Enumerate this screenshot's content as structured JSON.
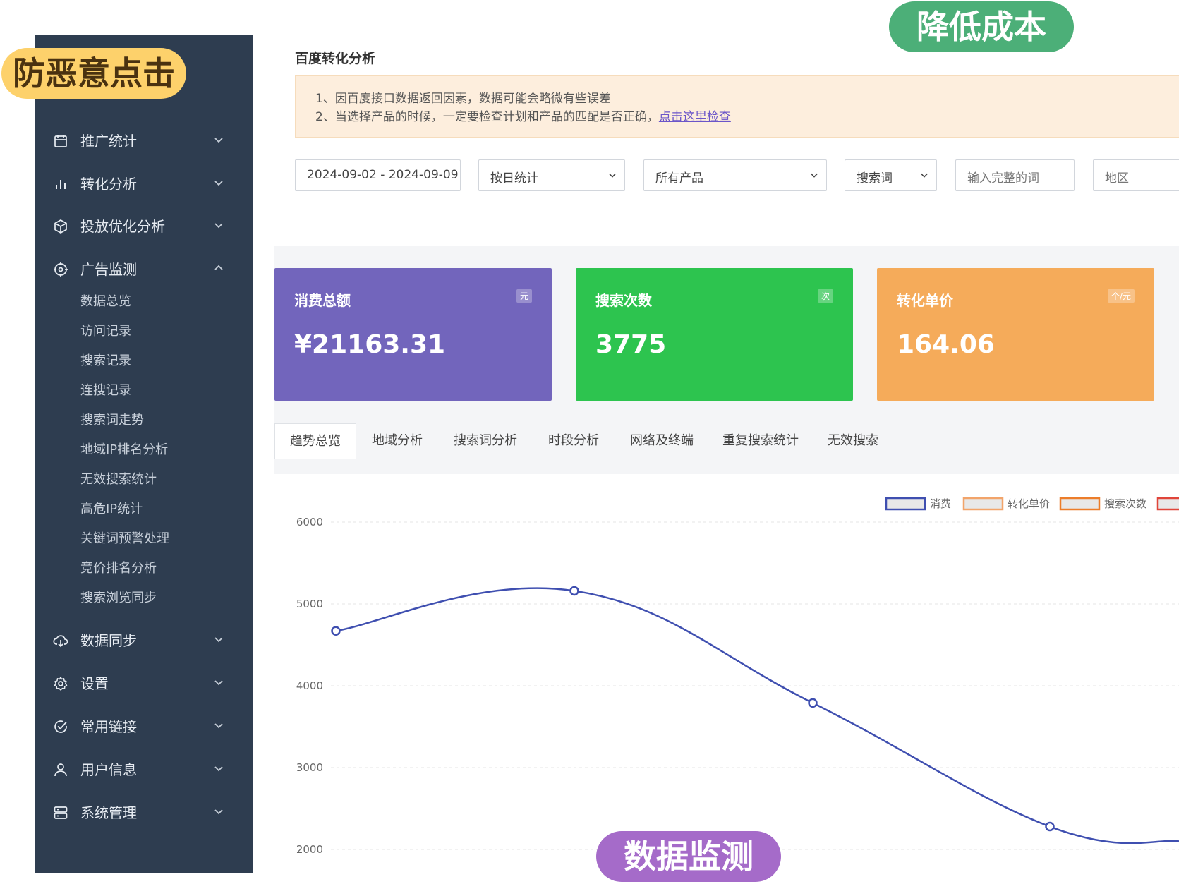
{
  "badges": {
    "top_left": "防恶意点击",
    "top_right": "降低成本",
    "bottom": "数据监测"
  },
  "sidebar": {
    "items": [
      {
        "label": "推广统计",
        "icon": "calendar-icon",
        "expanded": false
      },
      {
        "label": "转化分析",
        "icon": "bar-chart-icon",
        "expanded": false
      },
      {
        "label": "投放优化分析",
        "icon": "cube-icon",
        "expanded": false
      },
      {
        "label": "广告监测",
        "icon": "target-icon",
        "expanded": true
      },
      {
        "label": "数据同步",
        "icon": "cloud-download-icon",
        "expanded": false
      },
      {
        "label": "设置",
        "icon": "gear-icon",
        "expanded": false
      },
      {
        "label": "常用链接",
        "icon": "check-circle-icon",
        "expanded": false
      },
      {
        "label": "用户信息",
        "icon": "user-icon",
        "expanded": false
      },
      {
        "label": "系统管理",
        "icon": "server-icon",
        "expanded": false
      }
    ],
    "sub_items": [
      "数据总览",
      "访问记录",
      "搜索记录",
      "连搜记录",
      "搜索词走势",
      "地域IP排名分析",
      "无效搜索统计",
      "高危IP统计",
      "关键词预警处理",
      "竞价排名分析",
      "搜索浏览同步"
    ]
  },
  "main": {
    "title": "百度转化分析",
    "notice": {
      "line1": "1、因百度接口数据返回因素，数据可能会略微有些误差",
      "line2_prefix": "2、当选择产品的时候，一定要检查计划和产品的匹配是否正确，",
      "line2_link": "点击这里检查"
    },
    "filters": {
      "date_range": "2024-09-02 - 2024-09-09",
      "group_by": "按日统计",
      "product": "所有产品",
      "field": "搜索词",
      "keyword_placeholder": "输入完整的词",
      "region": "地区"
    },
    "stats": [
      {
        "title": "消费总额",
        "unit": "元",
        "value": "¥21163.31",
        "color": "#7265bc"
      },
      {
        "title": "搜索次数",
        "unit": "次",
        "value": "3775",
        "color": "#2dc44f"
      },
      {
        "title": "转化单价",
        "unit": "个/元",
        "value": "164.06",
        "color": "#f5ab5a"
      }
    ],
    "tabs": [
      "趋势总览",
      "地域分析",
      "搜索词分析",
      "时段分析",
      "网络及终端",
      "重复搜索统计",
      "无效搜索"
    ],
    "active_tab": 0
  },
  "chart_data": {
    "type": "line",
    "legend": [
      {
        "name": "消费",
        "color": "#3f4fb0"
      },
      {
        "name": "转化单价",
        "color": "#f2a46a"
      },
      {
        "name": "搜索次数",
        "color": "#ec7d2a"
      },
      {
        "name": "",
        "color": "#e0453a"
      }
    ],
    "yticks": [
      "6000",
      "5000",
      "4000",
      "3000",
      "2000"
    ],
    "ylim": [
      2000,
      6000
    ],
    "series": [
      {
        "name": "消费",
        "color": "#3f4fb0",
        "values": [
          4670,
          5160,
          3790,
          2280,
          2100
        ]
      }
    ],
    "grid": true,
    "legend_position": "top-right"
  }
}
